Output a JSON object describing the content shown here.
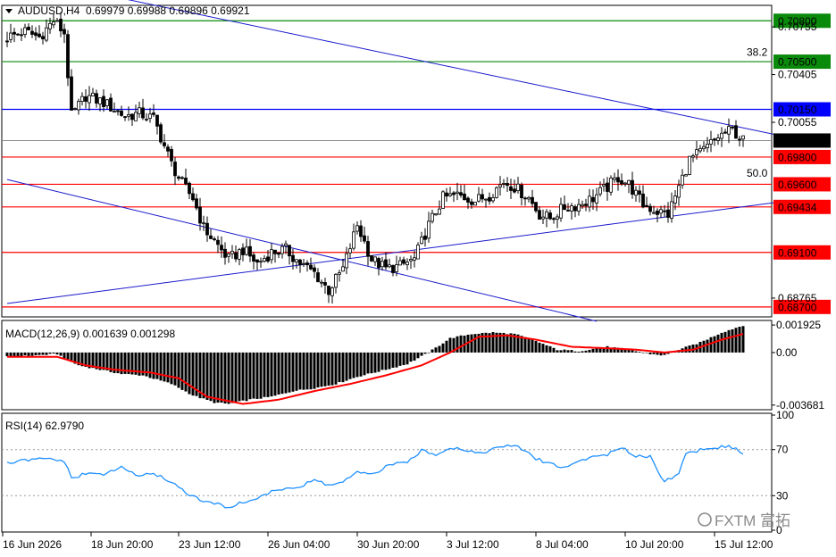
{
  "header": {
    "symbol": "AUDUSD,H4",
    "ohlc": "0.69979 0.69988 0.69896 0.69921"
  },
  "chart_data": [
    {
      "type": "candlestick",
      "ylim": [
        0.6864,
        0.709
      ],
      "price_tick_labels": [
        "0.70755",
        "0.70405",
        "0.70055",
        "0.68765"
      ],
      "current_price": "0.69921",
      "levels": [
        {
          "label": "0.70800",
          "value": 0.708,
          "color": "#0a8a0a"
        },
        {
          "label": "0.70500",
          "value": 0.705,
          "color": "#0a8a0a"
        },
        {
          "label": "0.70150",
          "value": 0.7015,
          "color": "#0000ff"
        },
        {
          "label": "0.69800",
          "value": 0.698,
          "color": "#ff0000"
        },
        {
          "label": "0.69600",
          "value": 0.696,
          "color": "#ff0000"
        },
        {
          "label": "0.69434",
          "value": 0.69434,
          "color": "#ff0000"
        },
        {
          "label": "0.69100",
          "value": 0.691,
          "color": "#ff0000"
        },
        {
          "label": "0.68700",
          "value": 0.687,
          "color": "#ff0000"
        }
      ],
      "fib_labels": [
        {
          "label": "38.2",
          "value": 0.7057
        },
        {
          "label": "50.0",
          "value": 0.6968
        }
      ],
      "close_anchors": [
        [
          0,
          0.7068
        ],
        [
          5,
          0.7072
        ],
        [
          9,
          0.7068
        ],
        [
          13,
          0.708
        ],
        [
          16,
          0.7071
        ],
        [
          18,
          0.701
        ],
        [
          22,
          0.7025
        ],
        [
          27,
          0.702
        ],
        [
          33,
          0.701
        ],
        [
          37,
          0.7012
        ],
        [
          41,
          0.7008
        ],
        [
          46,
          0.6975
        ],
        [
          49,
          0.696
        ],
        [
          52,
          0.695
        ],
        [
          55,
          0.6928
        ],
        [
          59,
          0.6915
        ],
        [
          62,
          0.6905
        ],
        [
          66,
          0.6912
        ],
        [
          70,
          0.6902
        ],
        [
          74,
          0.691
        ],
        [
          78,
          0.6912
        ],
        [
          82,
          0.6902
        ],
        [
          86,
          0.6895
        ],
        [
          90,
          0.6882
        ],
        [
          94,
          0.6898
        ],
        [
          98,
          0.693
        ],
        [
          102,
          0.6905
        ],
        [
          106,
          0.6898
        ],
        [
          110,
          0.69
        ],
        [
          114,
          0.6905
        ],
        [
          118,
          0.693
        ],
        [
          122,
          0.695
        ],
        [
          126,
          0.6952
        ],
        [
          131,
          0.6948
        ],
        [
          135,
          0.6952
        ],
        [
          139,
          0.6962
        ],
        [
          142,
          0.6958
        ],
        [
          146,
          0.695
        ],
        [
          149,
          0.6938
        ],
        [
          152,
          0.6935
        ],
        [
          156,
          0.6943
        ],
        [
          160,
          0.6945
        ],
        [
          164,
          0.695
        ],
        [
          168,
          0.6958
        ],
        [
          171,
          0.6965
        ],
        [
          174,
          0.696
        ],
        [
          178,
          0.6945
        ],
        [
          182,
          0.694
        ],
        [
          185,
          0.6938
        ],
        [
          188,
          0.6958
        ],
        [
          191,
          0.6978
        ],
        [
          195,
          0.6985
        ],
        [
          199,
          0.6995
        ],
        [
          203,
          0.7
        ],
        [
          206,
          0.6992
        ]
      ],
      "trendlines": [
        {
          "from": [
            0,
            0.7114
          ],
          "to": [
            215,
            0.69965
          ],
          "color": "#1a1acc"
        },
        {
          "from": [
            0,
            0.69635
          ],
          "to": [
            165,
            0.68595
          ],
          "color": "#1a1acc"
        },
        {
          "from": [
            0,
            0.68725
          ],
          "to": [
            215,
            0.69466
          ],
          "color": "#1a1acc"
        }
      ]
    },
    {
      "type": "bar+line",
      "title": "MACD(12,26,9) 0.001639 0.001298",
      "ylim": [
        -0.00388,
        0.00212
      ],
      "tick_labels": [
        "0.001925",
        "0.00",
        "-0.003681"
      ],
      "histogram_anchors": [
        [
          0,
          -0.0003
        ],
        [
          8,
          -0.0002
        ],
        [
          14,
          -0.0001
        ],
        [
          16,
          -0.0004
        ],
        [
          20,
          -0.0009
        ],
        [
          26,
          -0.0012
        ],
        [
          32,
          -0.0015
        ],
        [
          38,
          -0.0016
        ],
        [
          46,
          -0.0022
        ],
        [
          52,
          -0.003
        ],
        [
          58,
          -0.0035
        ],
        [
          62,
          -0.0036
        ],
        [
          68,
          -0.0033
        ],
        [
          74,
          -0.0031
        ],
        [
          80,
          -0.0027
        ],
        [
          86,
          -0.0025
        ],
        [
          92,
          -0.0022
        ],
        [
          98,
          -0.0017
        ],
        [
          106,
          -0.0012
        ],
        [
          112,
          -0.0008
        ],
        [
          118,
          0.0
        ],
        [
          124,
          0.001
        ],
        [
          130,
          0.0013
        ],
        [
          136,
          0.0014
        ],
        [
          142,
          0.0013
        ],
        [
          148,
          0.0008
        ],
        [
          154,
          0.0002
        ],
        [
          160,
          0.0001
        ],
        [
          168,
          0.0004
        ],
        [
          174,
          0.0002
        ],
        [
          180,
          -0.0001
        ],
        [
          184,
          -0.0002
        ],
        [
          188,
          0.0002
        ],
        [
          194,
          0.0007
        ],
        [
          200,
          0.0014
        ],
        [
          206,
          0.0019
        ]
      ],
      "signal_anchors": [
        [
          0,
          -0.0003
        ],
        [
          14,
          -0.0003
        ],
        [
          22,
          -0.0009
        ],
        [
          30,
          -0.0012
        ],
        [
          40,
          -0.0014
        ],
        [
          48,
          -0.0018
        ],
        [
          56,
          -0.0031
        ],
        [
          66,
          -0.0036
        ],
        [
          76,
          -0.0033
        ],
        [
          86,
          -0.0027
        ],
        [
          96,
          -0.0022
        ],
        [
          106,
          -0.0016
        ],
        [
          116,
          -0.0009
        ],
        [
          124,
          0.0
        ],
        [
          132,
          0.0011
        ],
        [
          140,
          0.0012
        ],
        [
          148,
          0.0009
        ],
        [
          158,
          0.0004
        ],
        [
          168,
          0.0003
        ],
        [
          176,
          0.0002
        ],
        [
          184,
          0.0
        ],
        [
          192,
          0.0002
        ],
        [
          200,
          0.0009
        ],
        [
          206,
          0.0013
        ]
      ]
    },
    {
      "type": "line",
      "title": "RSI(14) 62.9790",
      "ylim": [
        0,
        100
      ],
      "tick_labels": [
        "100",
        "70",
        "30",
        "0"
      ],
      "levels": [
        70,
        30
      ],
      "anchors": [
        [
          0,
          58
        ],
        [
          6,
          61
        ],
        [
          12,
          62
        ],
        [
          16,
          60
        ],
        [
          18,
          45
        ],
        [
          22,
          49
        ],
        [
          28,
          49
        ],
        [
          32,
          55
        ],
        [
          36,
          48
        ],
        [
          42,
          48
        ],
        [
          46,
          42
        ],
        [
          50,
          33
        ],
        [
          54,
          26
        ],
        [
          58,
          23
        ],
        [
          62,
          20
        ],
        [
          66,
          24
        ],
        [
          70,
          28
        ],
        [
          74,
          33
        ],
        [
          78,
          37
        ],
        [
          82,
          37
        ],
        [
          86,
          44
        ],
        [
          90,
          39
        ],
        [
          94,
          42
        ],
        [
          98,
          50
        ],
        [
          102,
          48
        ],
        [
          106,
          55
        ],
        [
          110,
          58
        ],
        [
          114,
          62
        ],
        [
          116,
          70
        ],
        [
          120,
          66
        ],
        [
          124,
          72
        ],
        [
          128,
          70
        ],
        [
          132,
          67
        ],
        [
          136,
          70
        ],
        [
          140,
          74
        ],
        [
          144,
          71
        ],
        [
          148,
          62
        ],
        [
          152,
          58
        ],
        [
          156,
          54
        ],
        [
          160,
          60
        ],
        [
          164,
          64
        ],
        [
          168,
          66
        ],
        [
          172,
          71
        ],
        [
          176,
          65
        ],
        [
          180,
          64
        ],
        [
          184,
          42
        ],
        [
          188,
          50
        ],
        [
          190,
          66
        ],
        [
          194,
          70
        ],
        [
          198,
          71
        ],
        [
          202,
          74
        ],
        [
          206,
          66
        ]
      ]
    }
  ],
  "x_axis_labels": [
    "16 Jun 2026",
    "18 Jun 20:00",
    "23 Jun 12:00",
    "26 Jun 04:00",
    "30 Jun 20:00",
    "3 Jul 12:00",
    "8 Jul 04:00",
    "10 Jul 20:00",
    "15 Jul 12:00"
  ],
  "watermark": "FXTM 富拓",
  "colors": {
    "candle_up": "#ffffff",
    "candle_down": "#000000",
    "macd_hist": "#000000",
    "macd_signal": "#ff0000",
    "rsi_line": "#1e90ff",
    "current_price_bg": "#000000",
    "frame": "#000000"
  }
}
